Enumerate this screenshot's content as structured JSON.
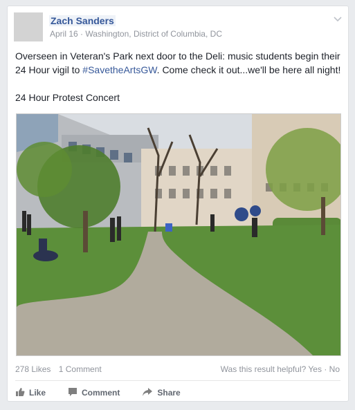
{
  "post": {
    "author": "Zach Sanders",
    "date": "April 16",
    "separator": " · ",
    "location": "Washington, District of Columbia, DC",
    "text_before": "Overseen in Veteran's Park next door to the Deli: music students begin their 24 Hour vigil to ",
    "hashtag": "#SavetheArtsGW",
    "text_after": ". Come check it out...we'll be here all night!",
    "attachment_title": "24 Hour Protest Concert"
  },
  "stats": {
    "likes": "278 Likes",
    "comments": "1 Comment"
  },
  "feedback": {
    "question": "Was this result helpful?",
    "yes": "Yes",
    "separator": " · ",
    "no": "No"
  },
  "actions": {
    "like": "Like",
    "comment": "Comment",
    "share": "Share"
  },
  "icons": [
    "chevron-down-icon",
    "like-icon",
    "comment-icon",
    "share-icon"
  ],
  "colors": {
    "link": "#365899",
    "meta": "#90949c",
    "background": "#e9ebee"
  }
}
